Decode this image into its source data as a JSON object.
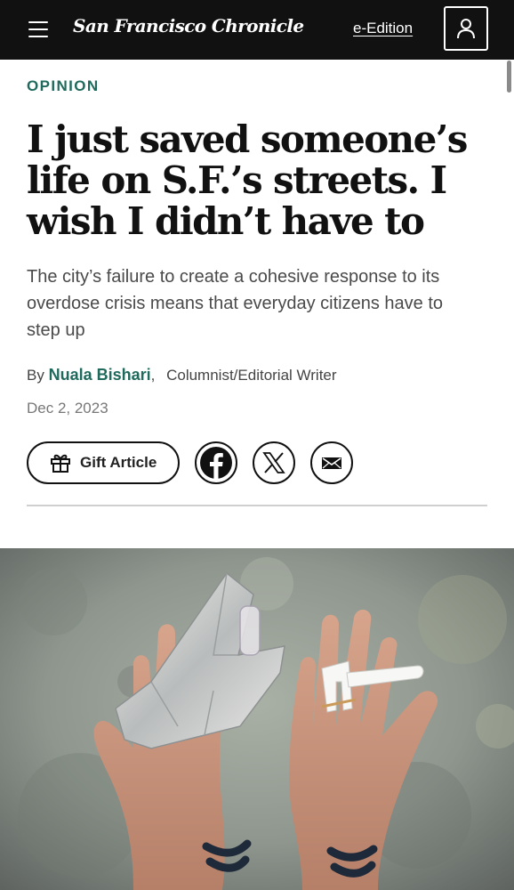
{
  "header": {
    "logo_text": "San Francisco Chronicle",
    "eedition_label": "e-Edition"
  },
  "article": {
    "section": "OPINION",
    "headline": "I just saved someone’s life on S.F.’s streets. I wish I didn’t have to",
    "dek": "The city’s failure to create a cohesive response to its overdose crisis means that everyday citizens have to step up",
    "byline": {
      "prefix": "By",
      "author": "Nuala Bishari",
      "separator": ",",
      "role": "Columnist/Editorial Writer"
    },
    "date": "Dec 2, 2023"
  },
  "share": {
    "gift_label": "Gift Article",
    "icons": [
      "facebook-icon",
      "x-icon",
      "email-icon"
    ]
  },
  "colors": {
    "header_bg": "#111111",
    "accent": "#1f6a5d"
  }
}
